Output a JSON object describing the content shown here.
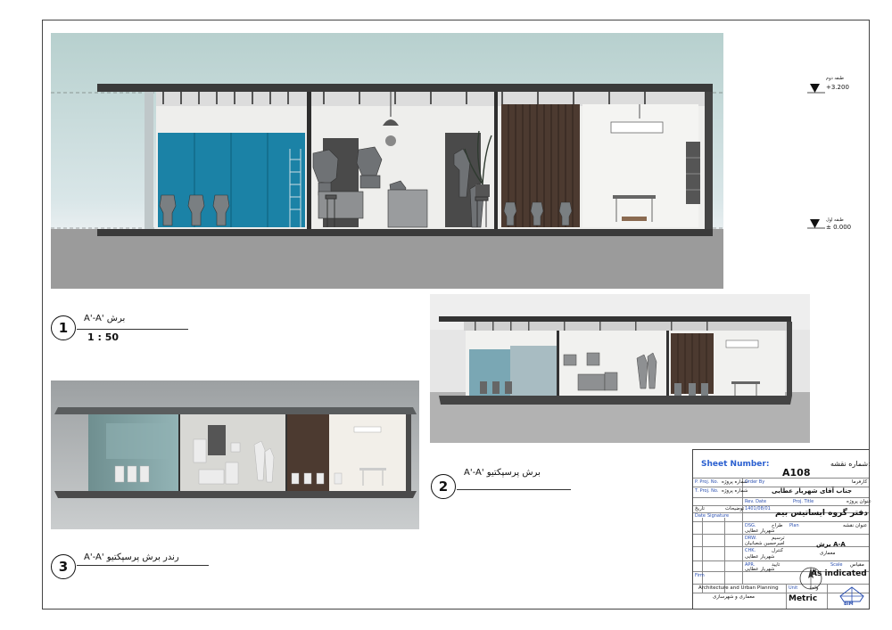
{
  "views": [
    {
      "number": "1",
      "name": "A'-A' برش",
      "scale": "1 : 50"
    },
    {
      "number": "2",
      "name": "A'-A' برش پرسپکتیو"
    },
    {
      "number": "3",
      "name": "A'-A' رندر برش پرسپکتیو"
    }
  ],
  "levels": [
    {
      "name": "طبقه دوم",
      "elevation": "+3.200"
    },
    {
      "name": "طبقه اول",
      "elevation": "± 0.000"
    }
  ],
  "title_block": {
    "sheet_number_label": "Sheet Number:",
    "sheet_number_fa": "شماره نقشه:",
    "sheet_number": "A108",
    "employer_label": "کارفرما",
    "order_by_label": "Order By",
    "employer_name": "جناب آقای شهریار عطایی",
    "project_code_label": "P. Proj. No.",
    "project_code_fa": "شماره پروژه",
    "temp_code_label": "T. Proj. No.",
    "temp_code_fa": "شماره پروژه",
    "project_title_label": "Proj. Title",
    "project_title_fa": "عنوان پروژه",
    "project_title": "دفتر گروه ایساتیس بیم",
    "rev_date_label": "Rev. Date",
    "rev_date_value": "1401/08/01",
    "date_label": "تاریخ",
    "desc_label": "توضیحات",
    "date_en": "Date",
    "signature_en": "Signature",
    "dsg_label": "DSG.",
    "dsg_fa": "طراح",
    "dsg_name": "شهریار عطایی",
    "drw_label": "DRW.",
    "drw_fa": "ترسیم",
    "drw_name": "امیرحسین شعبانیان",
    "chk_label": "CHK.",
    "chk_fa": "کنترل",
    "chk_name": "شهریار عطایی",
    "apr_label": "APR.",
    "apr_fa": "تایید",
    "apr_name": "شهریار عطایی",
    "plan_label": "Plan",
    "plan_fa": "عنوان نقشه",
    "plan_title": "برش A-A",
    "discipline": "معماری",
    "scale_label": "Scale",
    "scale_fa": "مقیاس",
    "scale_value": "As indicated",
    "unit_label": "Unit",
    "unit_fa": "واحد",
    "unit_value": "Metric",
    "firm_label": "Firm",
    "firm_en": "Architecture and Urban Planning",
    "firm_fa": "معماری و شهرسازی",
    "logo_text": "BIM",
    "compass_label": "N"
  }
}
